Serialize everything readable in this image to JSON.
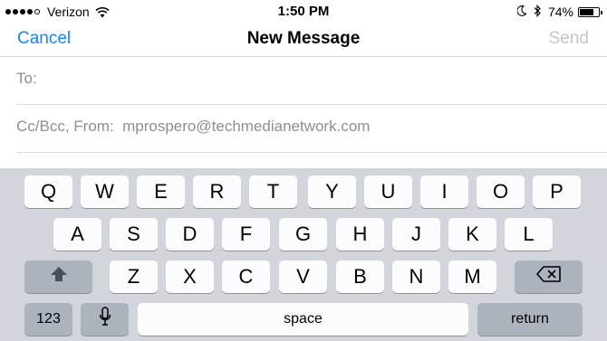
{
  "status_bar": {
    "carrier": "Verizon",
    "time": "1:50 PM",
    "battery_percent": "74%",
    "battery_level": 0.74,
    "signal_bars_filled": 4,
    "signal_bars_total": 5,
    "icons": [
      "wifi-icon",
      "moon-icon",
      "bluetooth-icon",
      "battery-icon"
    ]
  },
  "nav": {
    "cancel_label": "Cancel",
    "title": "New Message",
    "send_label": "Send",
    "accent_color": "#1a82fb",
    "disabled_color": "#c4c4c9"
  },
  "fields": {
    "to_label": "To:",
    "ccbcc_label": "Cc/Bcc, From:",
    "from_value": "mprospero@techmedianetwork.com"
  },
  "keyboard": {
    "row1": [
      "Q",
      "W",
      "E",
      "R",
      "T",
      "Y",
      "U",
      "I",
      "O",
      "P"
    ],
    "row2": [
      "A",
      "S",
      "D",
      "F",
      "G",
      "H",
      "J",
      "K",
      "L"
    ],
    "row3": [
      "Z",
      "X",
      "C",
      "V",
      "B",
      "N",
      "M"
    ],
    "shift_icon": "shift-arrow-icon",
    "delete_icon": "backspace-icon",
    "numbers_label": "123",
    "mic_icon": "microphone-icon",
    "space_label": "space",
    "return_label": "return"
  }
}
